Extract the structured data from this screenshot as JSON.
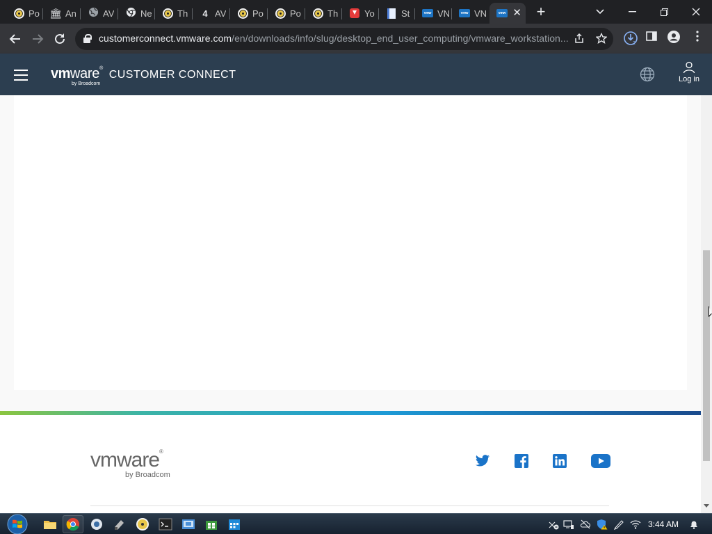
{
  "browser": {
    "tabs": [
      {
        "label": "Po",
        "icon": "disc-icon"
      },
      {
        "label": "An",
        "icon": "bank-icon"
      },
      {
        "label": "AV",
        "icon": "globe-icon"
      },
      {
        "label": "Ne",
        "icon": "chrome-icon"
      },
      {
        "label": "Th",
        "icon": "disc-icon"
      },
      {
        "label": "AV",
        "icon": "four-icon",
        "icon_text": "4"
      },
      {
        "label": "Po",
        "icon": "disc-icon"
      },
      {
        "label": "Po",
        "icon": "disc-icon"
      },
      {
        "label": "Th",
        "icon": "disc-icon"
      },
      {
        "label": "Yo",
        "icon": "download-icon"
      },
      {
        "label": "St",
        "icon": "document-icon"
      },
      {
        "label": "VN",
        "icon": "vmware-icon"
      },
      {
        "label": "VN",
        "icon": "vmware-icon"
      },
      {
        "label": "",
        "icon": "vmware-icon",
        "active": true
      }
    ],
    "vmware_favicon_text": "vmw",
    "close_glyph": "✕",
    "new_tab_glyph": "+",
    "url_host": "customerconnect.vmware.com",
    "url_path": "/en/downloads/info/slug/desktop_end_user_computing/vmware_workstation...",
    "window_controls": [
      "∨",
      "—",
      "❐",
      "✕"
    ],
    "accent": "#202124"
  },
  "site": {
    "brand_vm": "vm",
    "brand_ware": "ware",
    "brand_reg": "®",
    "brand_by": "by Broadcom",
    "brand_title": "CUSTOMER CONNECT",
    "login_label": "Log in",
    "header_color": "#2c3e50"
  },
  "footer": {
    "logo_text": "vmware",
    "logo_reg": "®",
    "logo_by": "by Broadcom",
    "social": [
      "twitter-icon",
      "facebook-icon",
      "linkedin-icon",
      "youtube-icon"
    ],
    "social_color": "#1a73c8"
  },
  "taskbar": {
    "clock": "3:44 AM",
    "apps": [
      "file-explorer-icon",
      "chrome-icon",
      "app-icon",
      "media-icon",
      "disc-icon",
      "terminal-icon",
      "vmware-icon",
      "store-icon",
      "calendar-icon"
    ]
  }
}
